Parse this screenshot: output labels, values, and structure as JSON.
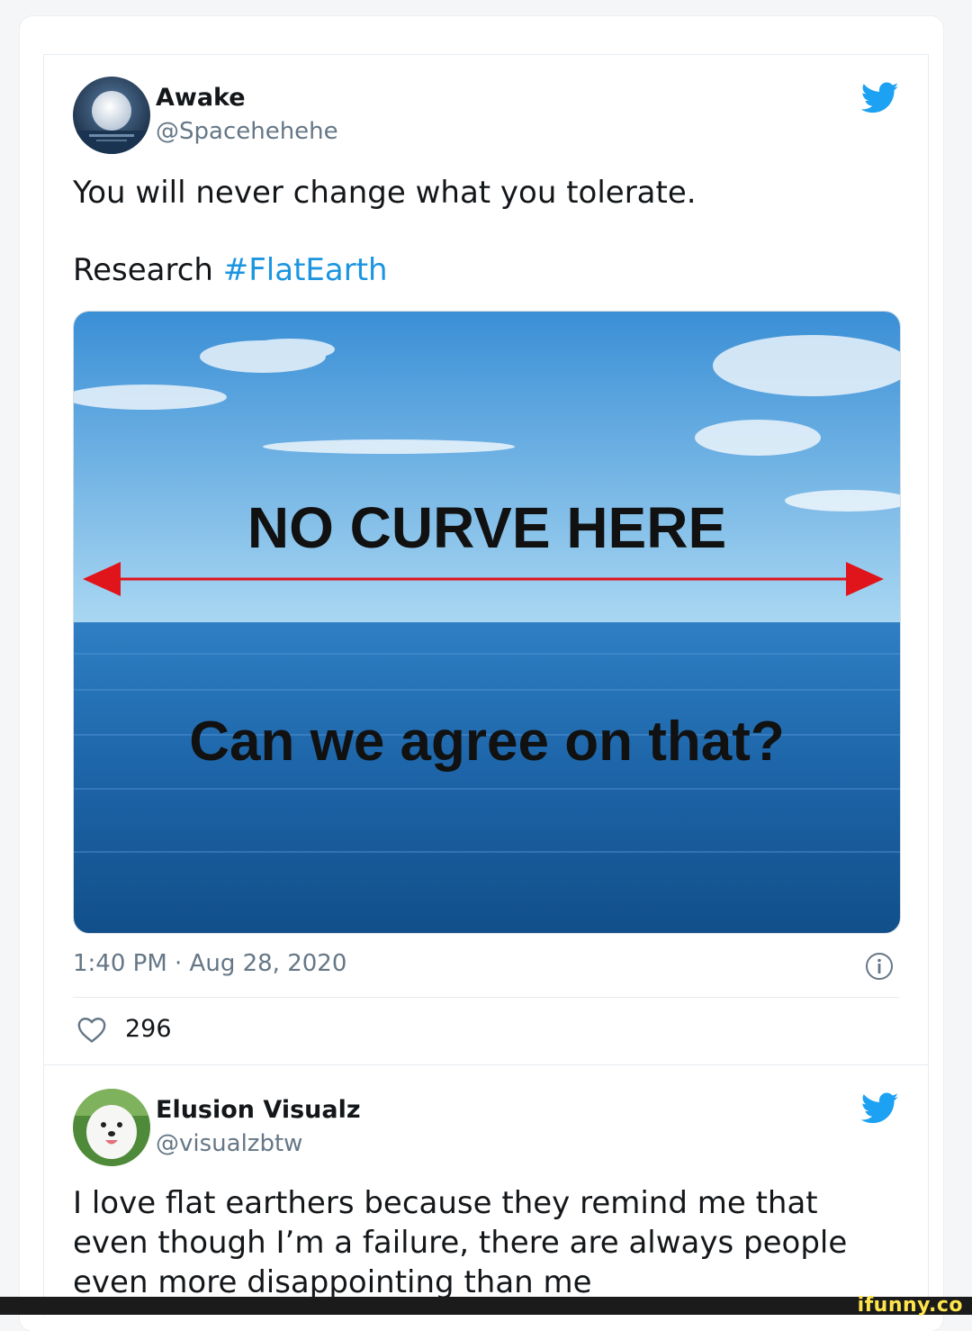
{
  "tweets": [
    {
      "name": "Awake",
      "handle": "@Spacehehehe",
      "text_line1": "You will never change what you tolerate.",
      "text_line2_prefix": "Research ",
      "hashtag": "#FlatEarth",
      "image_headline": "NO CURVE HERE",
      "image_question": "Can we agree on that?",
      "timestamp": "1:40 PM · Aug 28, 2020",
      "likes": "296"
    },
    {
      "name": "Elusion Visualz",
      "handle": "@visualzbtw",
      "text_lines": [
        "I love flat earthers because they remind me that",
        "even though I’m a failure, there are always people",
        "even more disappointing than me"
      ]
    }
  ],
  "watermark": "ifunny.co",
  "colors": {
    "brand_blue": "#1da1f2",
    "hashtag": "#1b95e0",
    "secondary_text": "#657786",
    "arrow_red": "#e0141b",
    "watermark": "#ffe54c"
  },
  "icons": [
    "twitter-bird-icon",
    "info-icon",
    "heart-icon"
  ]
}
